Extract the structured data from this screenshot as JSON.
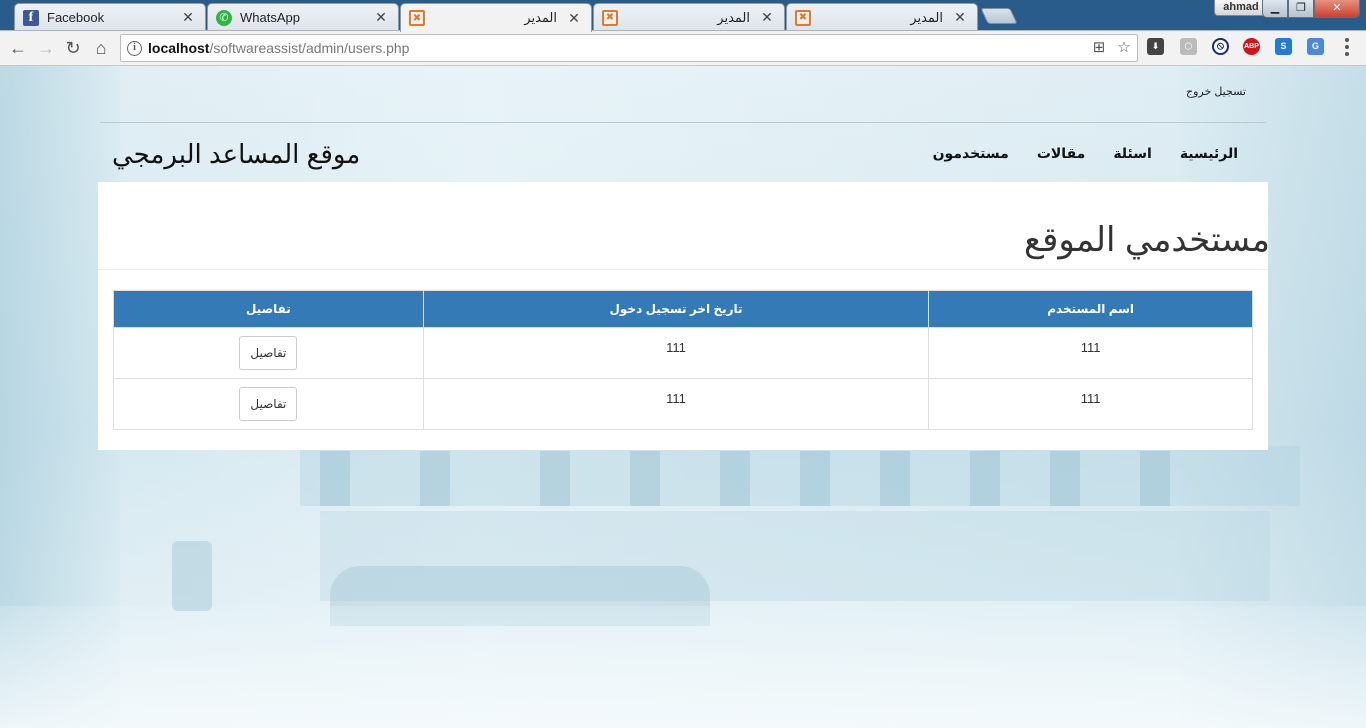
{
  "browser": {
    "tabs": [
      {
        "title": "Facebook",
        "icon": "facebook-icon"
      },
      {
        "title": "WhatsApp",
        "icon": "whatsapp-icon"
      },
      {
        "title": "المدير",
        "icon": "xampp-icon"
      },
      {
        "title": "المدير",
        "icon": "xampp-icon"
      },
      {
        "title": "المدير",
        "icon": "xampp-icon"
      }
    ],
    "active_tab": 2,
    "profile_name": "ahmad",
    "url_host": "localhost",
    "url_path": "/softwareassist/admin/users.php"
  },
  "site": {
    "logout": "تسجيل خروج",
    "title": "موقع المساعد البرمجي",
    "nav": [
      "الرئيسية",
      "اسئلة",
      "مقالات",
      "مستخدمون"
    ]
  },
  "page": {
    "heading": "مستخدمي الموقع",
    "table": {
      "headers": [
        "اسم المستخدم",
        "تاريخ اخر تسجيل دخول",
        "تفاصيل"
      ],
      "rows": [
        {
          "username": "111",
          "last_login": "111",
          "details_label": "تفاصيل"
        },
        {
          "username": "111",
          "last_login": "111",
          "details_label": "تفاصيل"
        }
      ]
    },
    "header_color": "#337ab7"
  }
}
